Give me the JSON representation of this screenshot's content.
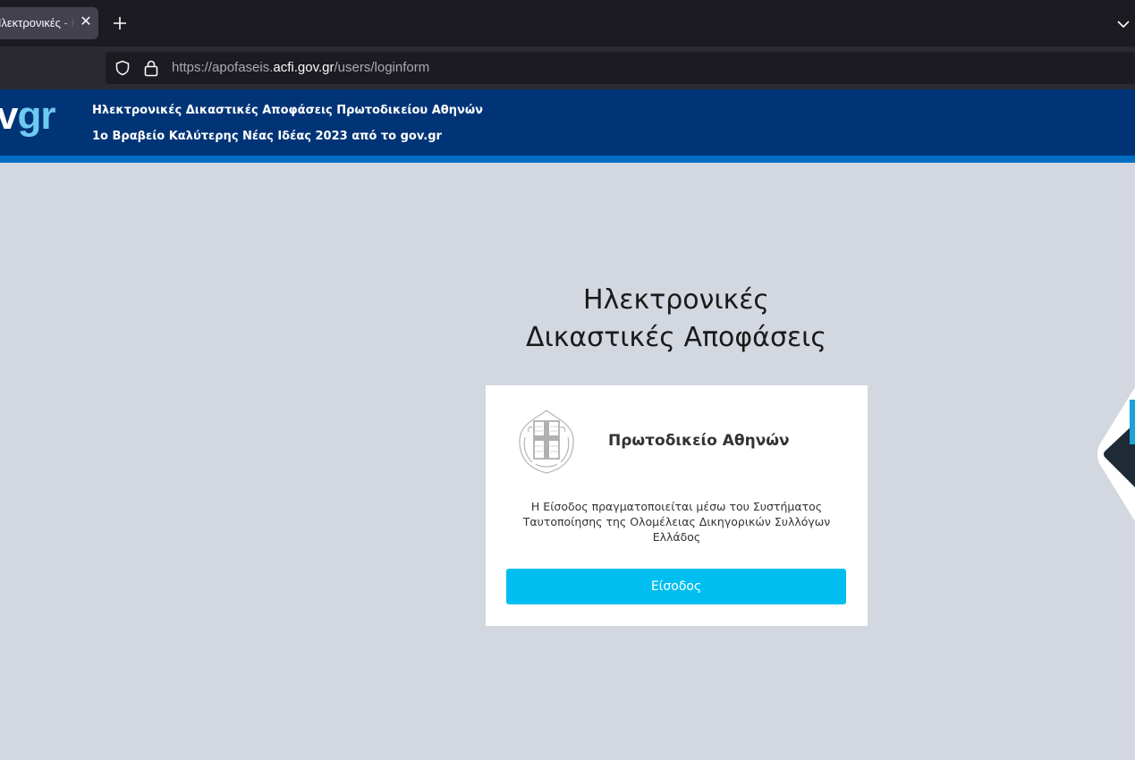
{
  "browser": {
    "tab_title": "Ηλεκτρονικές - Ηλεκτρ",
    "url_prefix": "https://apofaseis.",
    "url_domain": "acfi.gov.gr",
    "url_path": "/users/loginform"
  },
  "header": {
    "brand_left": "v",
    "brand_right": "gr",
    "line1": "Ηλεκτρονικές Δικαστικές Αποφάσεις Πρωτοδικείου Αθηνών",
    "line2": "1ο Βραβείο Καλύτερης Νέας Ιδέας 2023 από το gov.gr"
  },
  "main": {
    "title_line1": "Ηλεκτρονικές",
    "title_line2": "Δικαστικές Αποφάσεις"
  },
  "card": {
    "court_name": "Πρωτοδικείο Αθηνών",
    "info_line1": "Η Είσοδος πραγματοποιείται μέσω του Συστήματος",
    "info_line2": "Ταυτοποίησης της Ολομέλειας Δικηγορικών Συλλόγων",
    "info_line3": "Ελλάδος",
    "login_label": "Είσοδος"
  },
  "colors": {
    "header_bg": "#003476",
    "header_stripe": "#046ec5",
    "page_bg": "#d2d7e0",
    "button_bg": "#00bff0",
    "brand_accent": "#6fc9f2"
  },
  "icons": {
    "shield": "shield-icon",
    "lock": "lock-icon",
    "close": "close-icon",
    "plus": "plus-icon",
    "chevron": "chevron-down-icon",
    "emblem": "hellenic-emblem-icon"
  }
}
